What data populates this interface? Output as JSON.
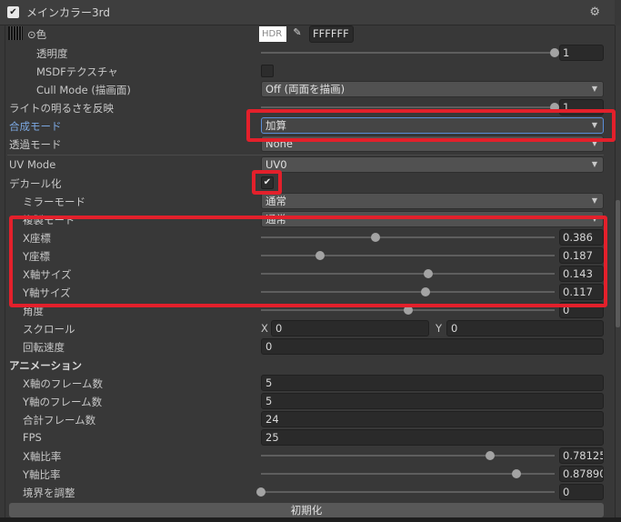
{
  "header": {
    "title": "メインカラー3rd",
    "enabled": true
  },
  "color": {
    "label": "⊙色",
    "hdr": "HDR",
    "hex": "FFFFFF"
  },
  "rows": [
    {
      "key": "opacity",
      "label": "透明度",
      "indent": 40,
      "type": "slider",
      "fraction": 1.0,
      "value": "1"
    },
    {
      "key": "msdf",
      "label": "MSDFテクスチャ",
      "indent": 40,
      "type": "checkbox",
      "checked": false
    },
    {
      "key": "cull",
      "label": "Cull Mode (描画面)",
      "indent": 40,
      "type": "dropdown",
      "value": "Off (両面を描画)"
    },
    {
      "key": "light",
      "label": "ライトの明るさを反映",
      "indent": 10,
      "type": "slider",
      "fraction": 1.0,
      "value": "1"
    },
    {
      "key": "blend",
      "label": "合成モード",
      "indent": 10,
      "type": "dropdown",
      "value": "加算",
      "blue": true,
      "active": true
    },
    {
      "key": "transparent",
      "label": "透過モード",
      "indent": 10,
      "type": "dropdown",
      "value": "None"
    },
    {
      "key": "uv",
      "label": "UV Mode",
      "indent": 10,
      "type": "dropdown",
      "value": "UV0"
    },
    {
      "key": "decal",
      "label": "デカール化",
      "indent": 10,
      "type": "checkbox",
      "checked": true
    },
    {
      "key": "mirror",
      "label": "ミラーモード",
      "indent": 25,
      "type": "dropdown",
      "value": "通常"
    },
    {
      "key": "copy",
      "label": "複製モード",
      "indent": 25,
      "type": "dropdown",
      "value": "通常"
    },
    {
      "key": "posx",
      "label": "X座標",
      "indent": 25,
      "type": "slider",
      "fraction": 0.39,
      "value": "0.386"
    },
    {
      "key": "posy",
      "label": "Y座標",
      "indent": 25,
      "type": "slider",
      "fraction": 0.2,
      "value": "0.187"
    },
    {
      "key": "sizex",
      "label": "X軸サイズ",
      "indent": 25,
      "type": "slider",
      "fraction": 0.57,
      "value": "0.143"
    },
    {
      "key": "sizey",
      "label": "Y軸サイズ",
      "indent": 25,
      "type": "slider",
      "fraction": 0.56,
      "value": "0.117"
    },
    {
      "key": "angle",
      "label": "角度",
      "indent": 25,
      "type": "slider",
      "fraction": 0.5,
      "value": "0"
    },
    {
      "key": "scroll",
      "label": "スクロール",
      "indent": 25,
      "type": "xy",
      "x_label": "X",
      "x": "0",
      "y_label": "Y",
      "y": "0"
    },
    {
      "key": "rotspeed",
      "label": "回転速度",
      "indent": 25,
      "type": "field",
      "value": "0"
    },
    {
      "key": "anim",
      "label": "アニメーション",
      "indent": 10,
      "type": "section"
    },
    {
      "key": "framesx",
      "label": "X軸のフレーム数",
      "indent": 25,
      "type": "field",
      "value": "5"
    },
    {
      "key": "framesy",
      "label": "Y軸のフレーム数",
      "indent": 25,
      "type": "field",
      "value": "5"
    },
    {
      "key": "frames",
      "label": "合計フレーム数",
      "indent": 25,
      "type": "field",
      "value": "24"
    },
    {
      "key": "fps",
      "label": "FPS",
      "indent": 25,
      "type": "field",
      "value": "25"
    },
    {
      "key": "ratiox",
      "label": "X軸比率",
      "indent": 25,
      "type": "slider",
      "fraction": 0.78,
      "value": "0.78125"
    },
    {
      "key": "ratioy",
      "label": "Y軸比率",
      "indent": 25,
      "type": "slider",
      "fraction": 0.87,
      "value": "0.87890"
    },
    {
      "key": "border",
      "label": "境界を調整",
      "indent": 25,
      "type": "slider",
      "fraction": 0.0,
      "value": "0"
    }
  ],
  "reset_button": "初期化",
  "icons": {
    "gear": "gear-icon",
    "dropdown": "chevron-down-icon",
    "eyedropper": "eyedropper-icon"
  }
}
